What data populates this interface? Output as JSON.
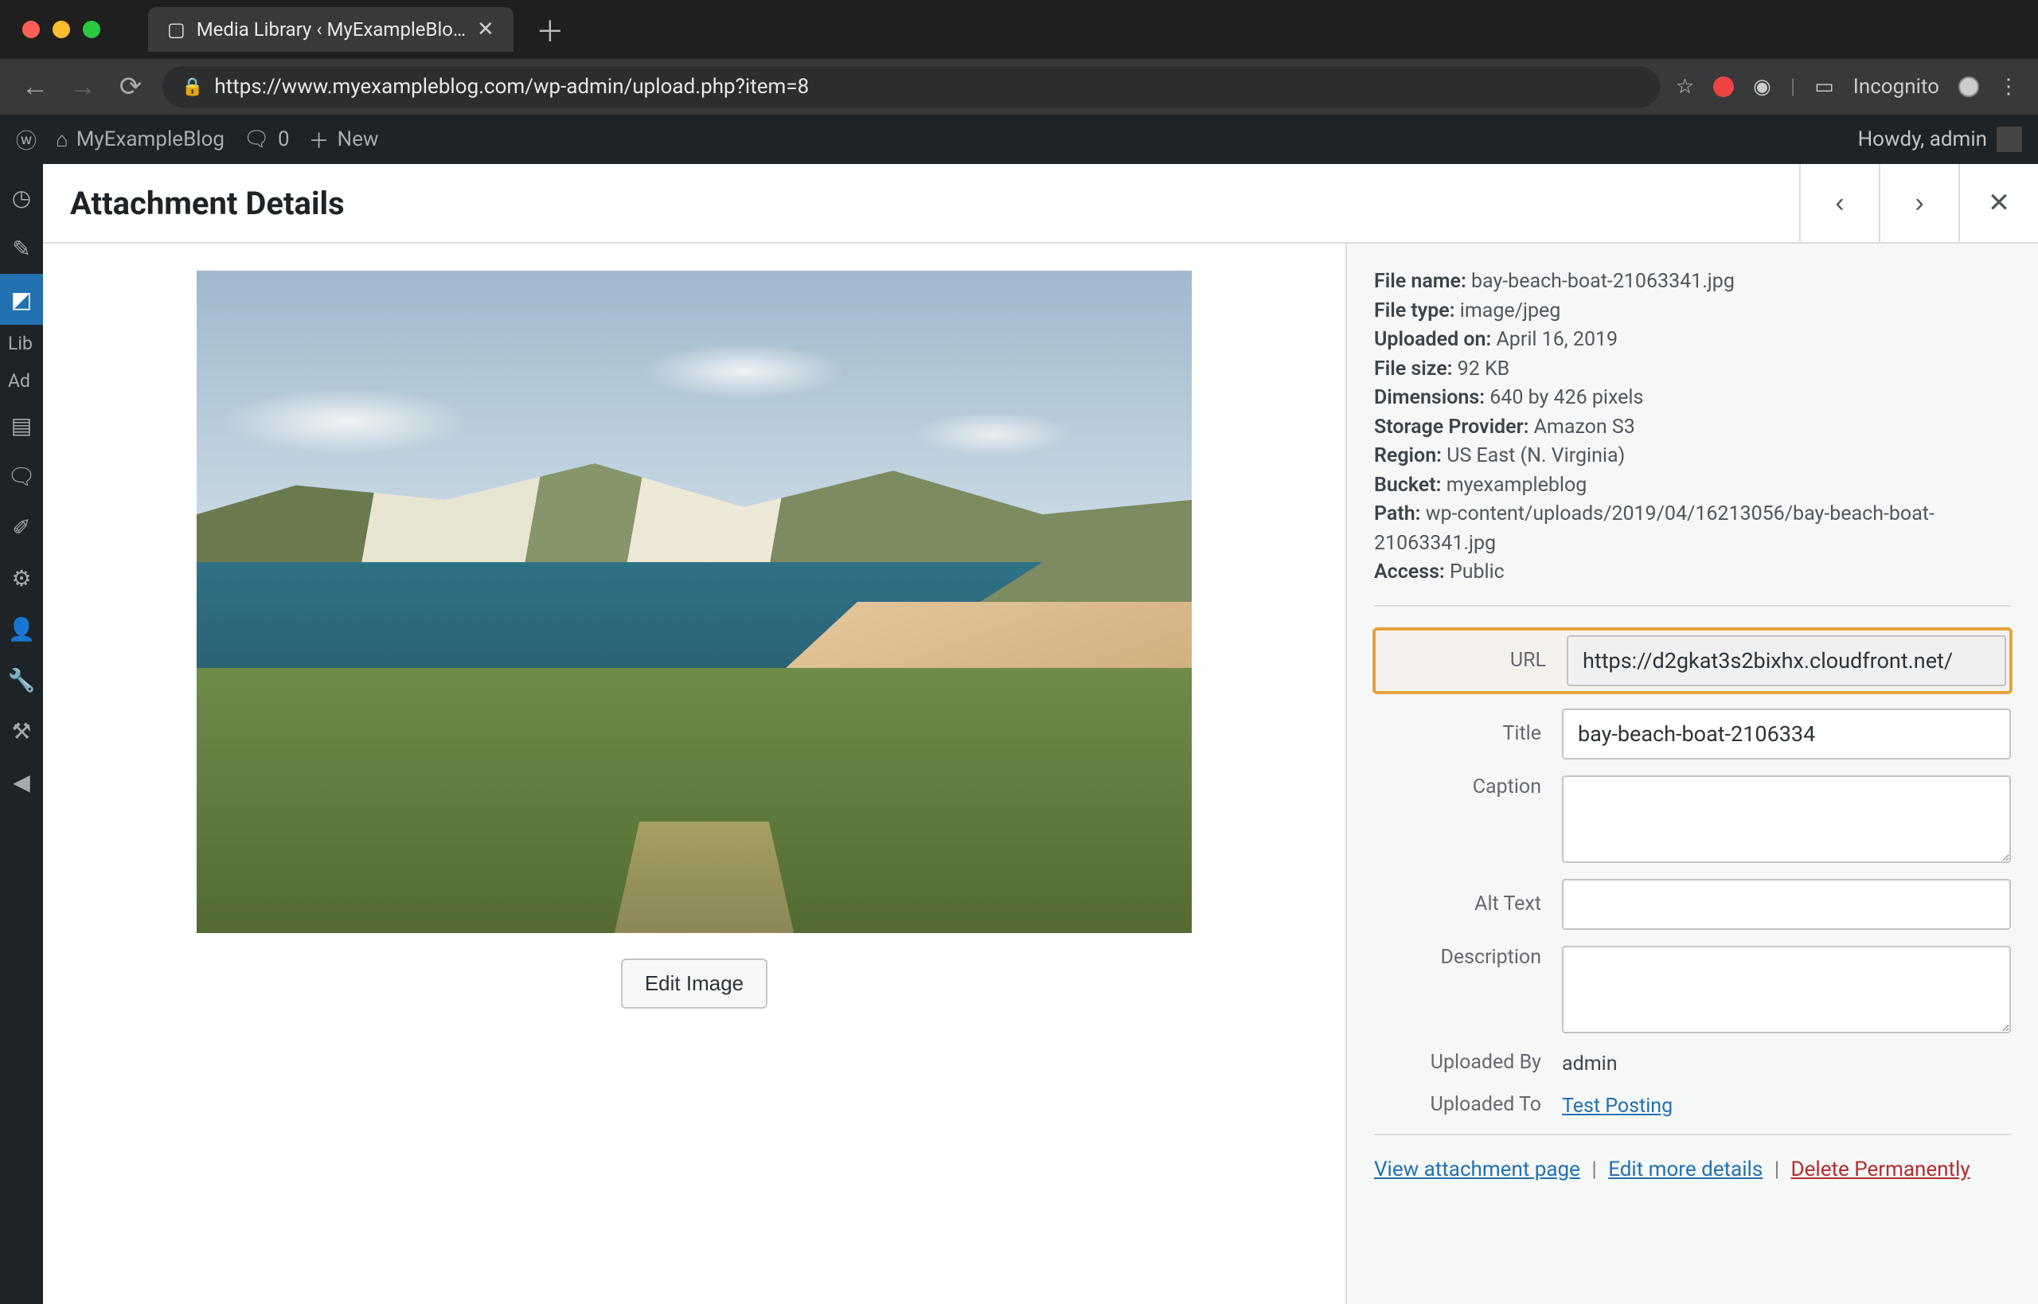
{
  "browser": {
    "tab_title": "Media Library ‹ MyExampleBlo…",
    "url": "https://www.myexampleblog.com/wp-admin/upload.php?item=8",
    "incognito_label": "Incognito"
  },
  "adminbar": {
    "site_name": "MyExampleBlog",
    "comments_count": "0",
    "new_label": "New",
    "howdy": "Howdy, admin"
  },
  "sidemenu": {
    "sub_library": "Lib",
    "sub_add": "Ad"
  },
  "modal": {
    "title": "Attachment Details",
    "edit_image_label": "Edit Image"
  },
  "details": {
    "rows": [
      {
        "k": "File name:",
        "v": "bay-beach-boat-21063341.jpg"
      },
      {
        "k": "File type:",
        "v": "image/jpeg"
      },
      {
        "k": "Uploaded on:",
        "v": "April 16, 2019"
      },
      {
        "k": "File size:",
        "v": "92 KB"
      },
      {
        "k": "Dimensions:",
        "v": "640 by 426 pixels"
      },
      {
        "k": "Storage Provider:",
        "v": "Amazon S3"
      },
      {
        "k": "Region:",
        "v": "US East (N. Virginia)"
      },
      {
        "k": "Bucket:",
        "v": "myexampleblog"
      },
      {
        "k": "Path:",
        "v": "wp-content/uploads/2019/04/16213056/bay-beach-boat-21063341.jpg"
      },
      {
        "k": "Access:",
        "v": "Public"
      }
    ]
  },
  "fields": {
    "url_label": "URL",
    "url_value": "https://d2gkat3s2bixhx.cloudfront.net/",
    "title_label": "Title",
    "title_value": "bay-beach-boat-2106334",
    "caption_label": "Caption",
    "caption_value": "",
    "alt_label": "Alt Text",
    "alt_value": "",
    "desc_label": "Description",
    "desc_value": "",
    "uploaded_by_label": "Uploaded By",
    "uploaded_by_value": "admin",
    "uploaded_to_label": "Uploaded To",
    "uploaded_to_value": "Test Posting"
  },
  "actions": {
    "view": "View attachment page",
    "edit": "Edit more details",
    "delete": "Delete Permanently"
  }
}
